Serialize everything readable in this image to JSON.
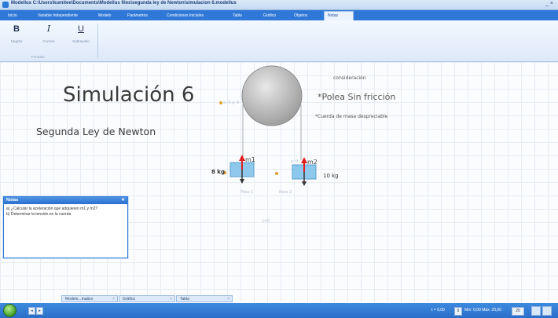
{
  "window": {
    "title": "Modellus   C:\\Users\\kumitee\\Documents\\Modellus files\\segunda ley de Newton\\simulacion 6.modellus",
    "controls": "_ ×"
  },
  "tabs": [
    "Inicio",
    "Variable Independiente",
    "Modelo",
    "Parámetros",
    "Condiciones Iniciales",
    "Tabla",
    "Gráfico",
    "Objetos",
    "Notas"
  ],
  "ribbon": {
    "bold": {
      "glyph": "B",
      "label": "Negrita"
    },
    "italic": {
      "glyph": "I",
      "label": "Cursiva"
    },
    "underline": {
      "glyph": "U",
      "label": "Subrayado"
    },
    "group_label": "Formato"
  },
  "canvas": {
    "title": "Simulación 6",
    "subtitle": "Segunda Ley de Newton",
    "consideration": "consideración",
    "pulley_note": "*Polea Sin fricción",
    "rope_note": "*Cuerda de masa despreciable",
    "pulley_small": "x: 0   y: 0",
    "mass1_label": "m1",
    "mass2_label": "m2",
    "mass1_value": "8 kg",
    "mass2_value": "10 kg",
    "weight1_label": "Peso 1",
    "weight2_label": "Peso 2",
    "vector_small": "y: 0",
    "small_center": "t=0"
  },
  "notes": {
    "header": "Notas",
    "line1": "a) ¿Calcular la aceleración que adquieren m1 y m2?",
    "line2": "b) Determinar la tensión en la cuerda"
  },
  "bottom_tabs": [
    "Modelo...matico",
    "Gráfico",
    "Tabla"
  ],
  "status": {
    "t_label": "t = 0,00",
    "range_label": "Mín: 0,00  Máx: 20,00",
    "steps": "20"
  },
  "colors": {
    "accent": "#2f78d8",
    "mass_fill": "#8ec8ec",
    "arrow_red": "#e21f1f",
    "pulley": "#b5b5b5"
  }
}
